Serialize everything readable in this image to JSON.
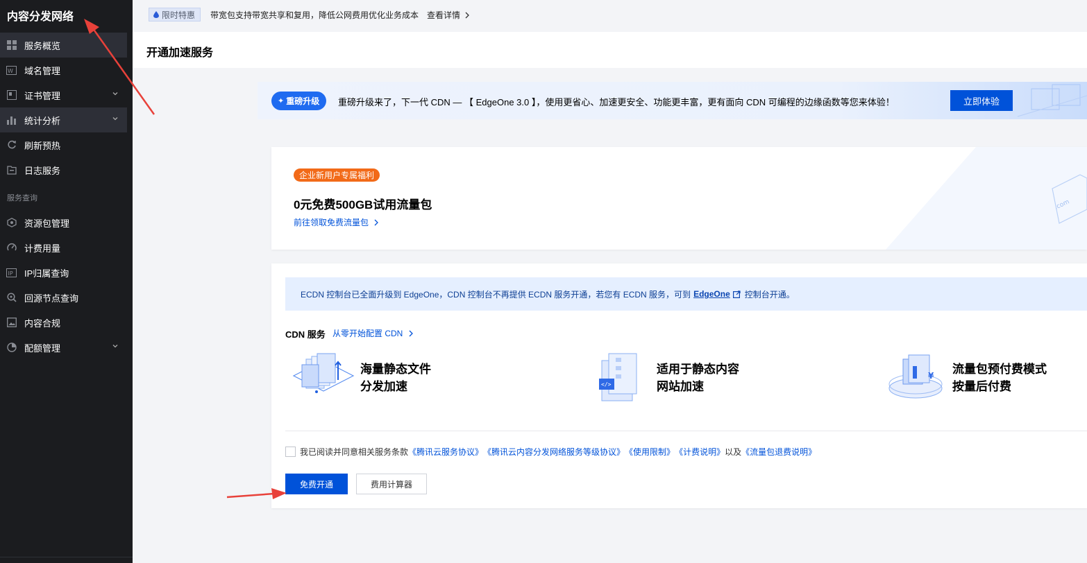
{
  "sidebar": {
    "title": "内容分发网络",
    "items": [
      {
        "label": "服务概览",
        "icon": "grid-icon"
      },
      {
        "label": "域名管理",
        "icon": "domain-icon"
      },
      {
        "label": "证书管理",
        "icon": "certificate-icon"
      },
      {
        "label": "统计分析",
        "icon": "bar-chart-icon"
      },
      {
        "label": "刷新预热",
        "icon": "refresh-icon"
      },
      {
        "label": "日志服务",
        "icon": "log-icon"
      }
    ],
    "section_label": "服务查询",
    "section_items": [
      {
        "label": "资源包管理",
        "icon": "package-icon"
      },
      {
        "label": "计费用量",
        "icon": "gauge-icon"
      },
      {
        "label": "IP归属查询",
        "icon": "ip-icon"
      },
      {
        "label": "回源节点查询",
        "icon": "search-node-icon"
      },
      {
        "label": "内容合规",
        "icon": "image-icon"
      },
      {
        "label": "配额管理",
        "icon": "pie-icon"
      }
    ]
  },
  "topbar": {
    "tag": "限时特惠",
    "text": "带宽包支持带宽共享和复用，降低公网费用优化业务成本",
    "link": "查看详情"
  },
  "page": {
    "title": "开通加速服务"
  },
  "upgrade": {
    "badge": "重磅升级",
    "text": "重磅升级来了，下一代 CDN — 【 EdgeOne 3.0 】，使用更省心、加速更安全、功能更丰富，更有面向 CDN 可编程的边缘函数等您来体验！",
    "button": "立即体验"
  },
  "free_card": {
    "tag": "企业新用户专属福利",
    "title": "0元免费500GB试用流量包",
    "link": "前往领取免费流量包"
  },
  "service": {
    "notice_prefix": "ECDN 控制台已全面升级到 EdgeOne，CDN 控制台不再提供 ECDN 服务开通，若您有 ECDN 服务，可到",
    "notice_link": "EdgeOne",
    "notice_suffix": "控制台开通。",
    "heading": "CDN 服务",
    "heading_link": "从零开始配置 CDN",
    "features": [
      {
        "line1": "海量静态文件",
        "line2": "分发加速"
      },
      {
        "line1": "适用于静态内容",
        "line2": "网站加速"
      },
      {
        "line1": "流量包预付费模式",
        "line2": "按量后付费"
      }
    ],
    "agree_prefix": "我已阅读并同意相关服务条款",
    "agree_links": [
      "《腾讯云服务协议》",
      "《腾讯云内容分发网络服务等级协议》",
      "《使用限制》",
      "《计费说明》"
    ],
    "agree_and": "以及",
    "agree_last": "《流量包退费说明》",
    "primary_button": "免费开通",
    "secondary_button": "费用计算器"
  },
  "colors": {
    "sidebar_bg": "#1b1c1f",
    "primary": "#0052d9",
    "orange": "#f26a18",
    "annotation_arrow": "#e8413a"
  }
}
